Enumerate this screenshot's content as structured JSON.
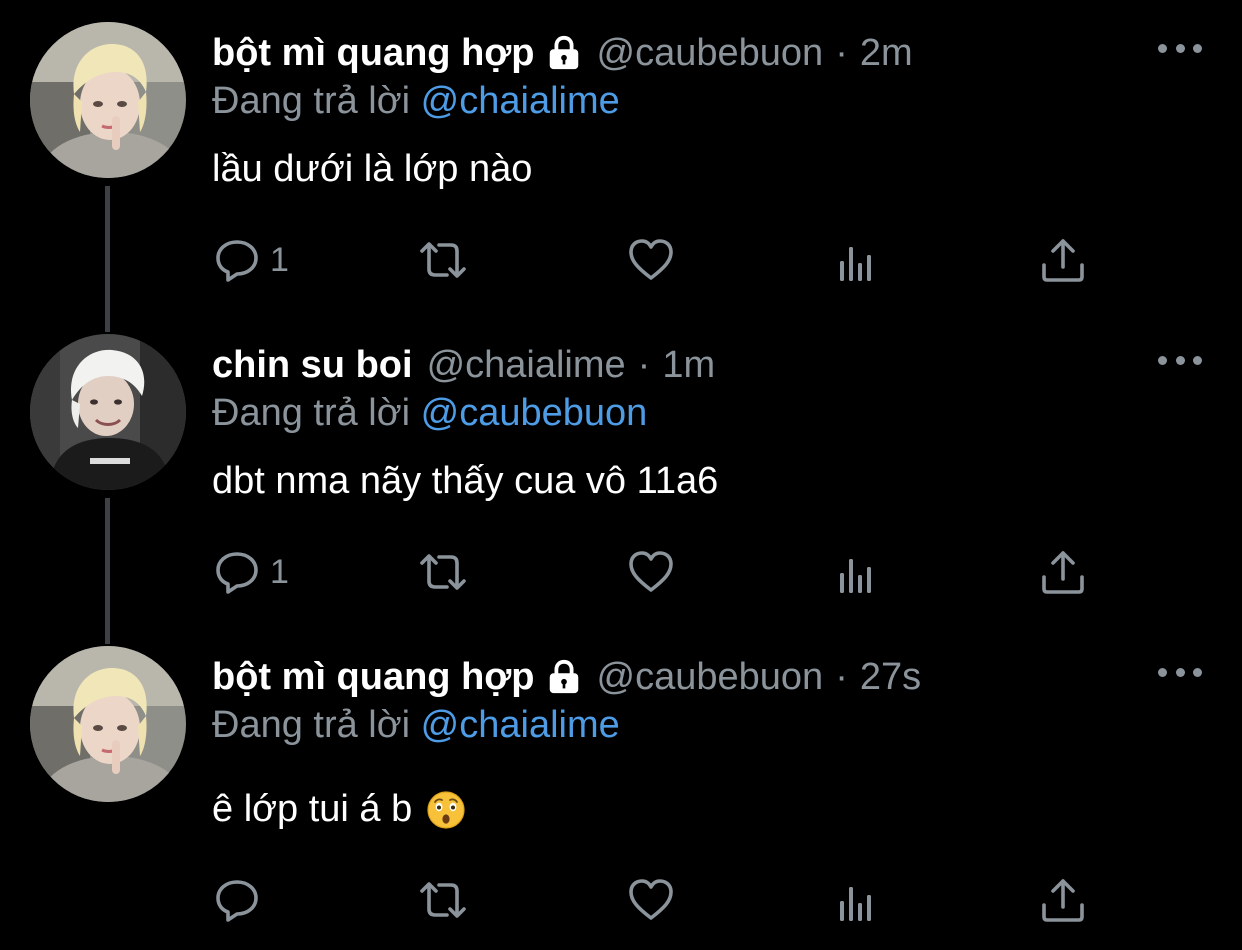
{
  "colors": {
    "background": "#000000",
    "name": "#ffffff",
    "muted": "#8b939b",
    "mention": "#4e9ce6",
    "thread_line": "#3d4044"
  },
  "tweets": [
    {
      "name": "bột mì quang hợp",
      "protected": true,
      "handle": "@caubebuon",
      "separator": "·",
      "time": "2m",
      "reply_prefix": "Đang trả lời",
      "reply_to": "@chaialime",
      "text": "lầu dưới là lớp nào",
      "reply_count": "1",
      "icons": [
        "reply-icon",
        "retweet-icon",
        "like-icon",
        "analytics-icon",
        "share-icon"
      ]
    },
    {
      "name": "chin su boi",
      "protected": false,
      "handle": "@chaialime",
      "separator": "·",
      "time": "1m",
      "reply_prefix": "Đang trả lời",
      "reply_to": "@caubebuon",
      "text": "dbt nma nãy thấy cua vô 11a6",
      "reply_count": "1",
      "icons": [
        "reply-icon",
        "retweet-icon",
        "like-icon",
        "analytics-icon",
        "share-icon"
      ]
    },
    {
      "name": "bột mì quang hợp",
      "protected": true,
      "handle": "@caubebuon",
      "separator": "·",
      "time": "27s",
      "reply_prefix": "Đang trả lời",
      "reply_to": "@chaialime",
      "text": "ê lớp tui á b",
      "text_emoji": "hushed-face-emoji",
      "reply_count": "",
      "icons": [
        "reply-icon",
        "retweet-icon",
        "like-icon",
        "analytics-icon",
        "share-icon"
      ]
    }
  ]
}
